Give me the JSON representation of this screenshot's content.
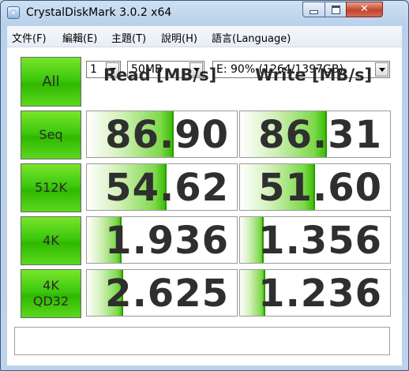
{
  "window": {
    "title": "CrystalDiskMark 3.0.2 x64"
  },
  "caption": {
    "close": "✕"
  },
  "menu": [
    "文件(F)",
    "編輯(E)",
    "主題(T)",
    "說明(H)",
    "語言(Language)"
  ],
  "controls": {
    "all_label": "All",
    "count": "1",
    "size": "50MB",
    "drive": "E: 90% (1264/1397GB)"
  },
  "headers": {
    "read": "Read [MB/s]",
    "write": "Write [MB/s]"
  },
  "tests": [
    {
      "label": "Seq",
      "read": "86.90",
      "write": "86.31",
      "read_level": 0.58,
      "write_level": 0.58
    },
    {
      "label": "512K",
      "read": "54.62",
      "write": "51.60",
      "read_level": 0.53,
      "write_level": 0.5
    },
    {
      "label": "4K",
      "read": "1.936",
      "write": "1.356",
      "read_level": 0.23,
      "write_level": 0.16
    },
    {
      "label": "4K\nQD32",
      "read": "2.625",
      "write": "1.236",
      "read_level": 0.24,
      "write_level": 0.17
    }
  ],
  "comment": ""
}
